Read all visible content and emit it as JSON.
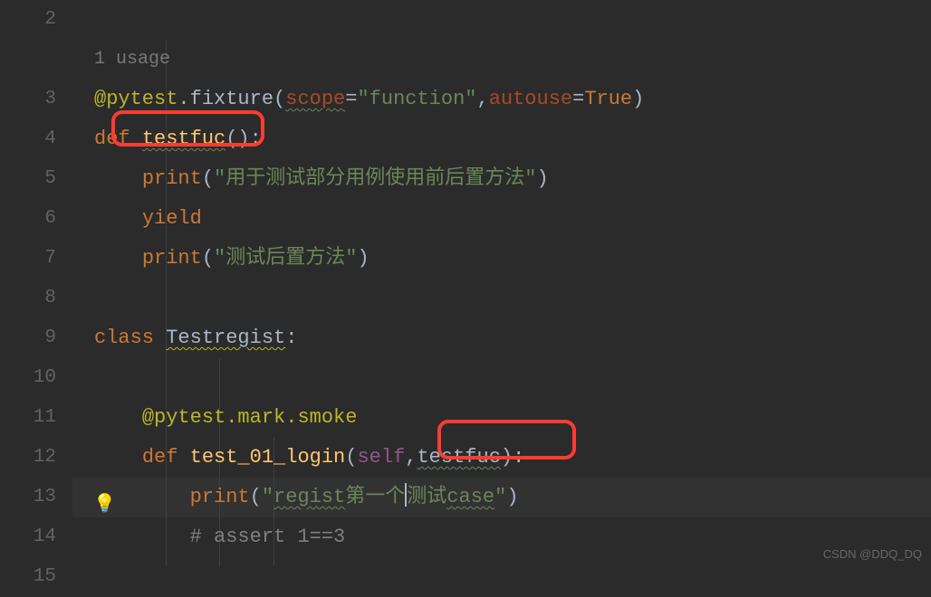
{
  "usage_hint": "1 usage",
  "lines": {
    "2": "2",
    "3": "3",
    "4": "4",
    "5": "5",
    "6": "6",
    "7": "7",
    "8": "8",
    "9": "9",
    "10": "10",
    "11": "11",
    "12": "12",
    "13": "13",
    "14": "14",
    "15": "15"
  },
  "code": {
    "decor1_at": "@pytest",
    "decor1_dot": ".",
    "decor1_fn": "fixture",
    "decor1_paren_open": "(",
    "decor1_p1": "scope",
    "decor1_eq1": "=",
    "decor1_v1": "\"function\"",
    "decor1_comma": ",",
    "decor1_p2": "autouse",
    "decor1_eq2": "=",
    "decor1_v2": "True",
    "decor1_paren_close": ")",
    "def1": "def",
    "fn1": "testfuc",
    "fn1_paren": "():",
    "print": "print",
    "str1": "\"用于测试部分用例使用前后置方法\"",
    "yield": "yield",
    "str2": "\"测试后置方法\"",
    "class": "class",
    "classname": "Testregist",
    "classcolon": ":",
    "decor2": "@pytest.mark.smoke",
    "def2": "def",
    "fn2": "test_01_login",
    "paren2_open": "(",
    "self": "self",
    "comma2": ",",
    "param2": "testfuc",
    "paren2_close": "):",
    "str3a": "\"",
    "str3b": "regist",
    "str3c": "第一个",
    "str3d": "测试",
    "str3e": "case",
    "str3f": "\"",
    "comment": "# assert 1==3"
  },
  "watermark": "CSDN @DDQ_DQ"
}
